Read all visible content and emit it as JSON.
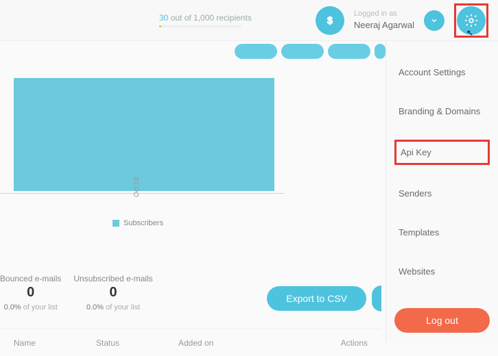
{
  "topbar": {
    "recipients_count": "30",
    "recipients_text": " out of 1,000 recipients",
    "logged_in_label": "Logged in as",
    "user_name": "Neeraj Agarwal"
  },
  "chart_data": {
    "type": "bar",
    "categories": [
      "Oct 18"
    ],
    "series": [
      {
        "name": "Subscribers",
        "values": [
          1
        ]
      }
    ],
    "title": "",
    "xlabel": "",
    "ylabel": "",
    "ylim": [
      0,
      1
    ],
    "legend": [
      "Subscribers"
    ]
  },
  "stats": {
    "bounced": {
      "label": "Bounced e-mails",
      "value": "0",
      "pct": "0.0%",
      "sub": " of your list"
    },
    "unsub": {
      "label": "Unsubscribed e-mails",
      "value": "0",
      "pct": "0.0%",
      "sub": " of your list"
    }
  },
  "buttons": {
    "export_csv": "Export to CSV",
    "logout": "Log out"
  },
  "table": {
    "name": "Name",
    "status": "Status",
    "added_on": "Added on",
    "actions": "Actions"
  },
  "dropdown": {
    "account_settings": "Account Settings",
    "branding_domains": "Branding & Domains",
    "api_key": "Api Key",
    "senders": "Senders",
    "templates": "Templates",
    "websites": "Websites"
  }
}
